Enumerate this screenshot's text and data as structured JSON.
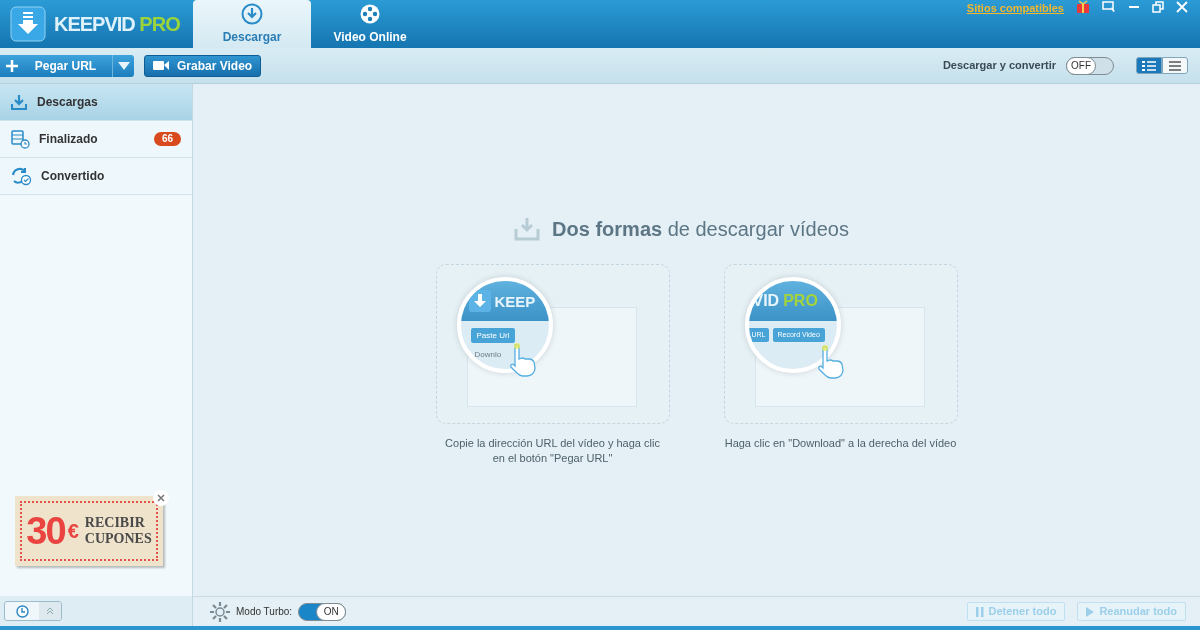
{
  "app": {
    "logo_main": "KEEPVID",
    "logo_accent": "PRO"
  },
  "tabs": [
    {
      "label": "Descargar",
      "selected": true
    },
    {
      "label": "Video Online",
      "selected": false
    }
  ],
  "title_bar": {
    "link": "Sitios compatibles"
  },
  "toolbar": {
    "paste_button": "Pegar URL",
    "record_button": "Grabar Video",
    "convert_label": "Descargar y convertir",
    "convert_toggle": {
      "on": false,
      "label": "OFF"
    },
    "views": [
      {
        "kind": "detailed",
        "selected": true
      },
      {
        "kind": "list",
        "selected": false
      }
    ]
  },
  "sidebar": {
    "items": [
      {
        "label": "Descargas",
        "selected": true
      },
      {
        "label": "Finalizado",
        "selected": false,
        "badge": "66"
      },
      {
        "label": "Convertido",
        "selected": false
      }
    ]
  },
  "promo": {
    "amount": "30",
    "currency": "€",
    "line_1": "RECIBIR",
    "line_2": "CUPONES"
  },
  "main": {
    "heading": "**Dos formas** de descargar vídeos",
    "cards": [
      {
        "kind": "paste",
        "logo": "KEEP",
        "button": "Paste Url",
        "item": "Downlo",
        "caption": "Copie la dirección URL del vídeo y haga clic\nen el botón \"Pegar URL\""
      },
      {
        "kind": "record",
        "logo": "VID",
        "logo_accent": "PRO",
        "button_left": "URL",
        "button": "Record Video",
        "caption": "Haga clic en \"Download\" a la derecha del vídeo"
      }
    ]
  },
  "footer": {
    "turbo_label": "Modo Turbo:",
    "turbo_toggle": {
      "on": true,
      "label": "ON"
    },
    "buttons": [
      {
        "label": "Detener todo",
        "disabled": true
      },
      {
        "label": "Reanudar todo",
        "disabled": true
      }
    ]
  }
}
